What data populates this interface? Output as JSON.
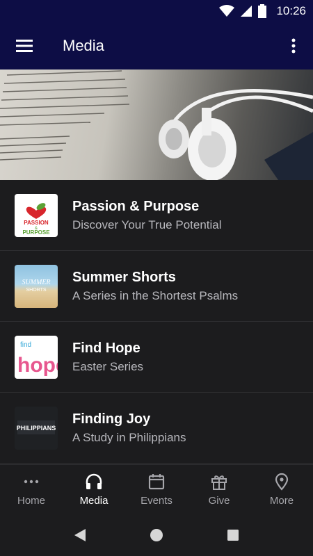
{
  "status_bar": {
    "time": "10:26"
  },
  "app_bar": {
    "title": "Media"
  },
  "media_items": [
    {
      "title": "Passion & Purpose",
      "subtitle": "Discover Your True Potential",
      "thumb_text": [
        "PASSION",
        "&",
        "PURPOSE"
      ]
    },
    {
      "title": "Summer Shorts",
      "subtitle": "A Series in the Shortest Psalms",
      "thumb_text": [
        "SUMMER",
        "SHORTS"
      ]
    },
    {
      "title": "Find Hope",
      "subtitle": "Easter Series",
      "thumb_text": [
        "find",
        "hope"
      ]
    },
    {
      "title": "Finding Joy",
      "subtitle": "A Study in Philippians",
      "thumb_text": [
        "PHILIPPIANS"
      ]
    }
  ],
  "bottom_nav": {
    "items": [
      {
        "label": "Home",
        "icon": "dots-icon"
      },
      {
        "label": "Media",
        "icon": "headphones-icon",
        "active": true
      },
      {
        "label": "Events",
        "icon": "calendar-icon"
      },
      {
        "label": "Give",
        "icon": "gift-icon"
      },
      {
        "label": "More",
        "icon": "location-pin-icon"
      }
    ]
  },
  "colors": {
    "app_bar": "#0d0d45",
    "background": "#1c1c1e",
    "inactive": "#a6a6ab"
  }
}
